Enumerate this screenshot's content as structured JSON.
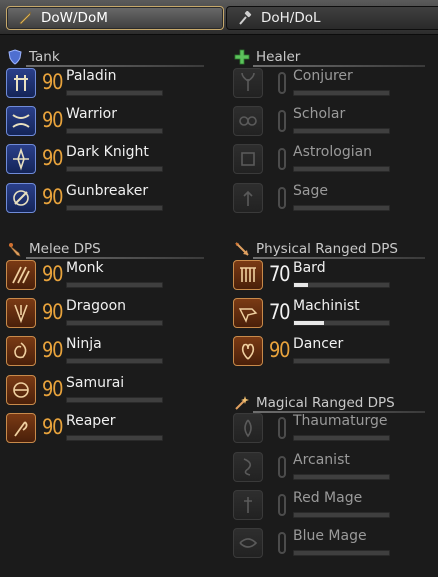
{
  "tabs": [
    {
      "label": "DoW/DoM",
      "icon": "sword-icon"
    },
    {
      "label": "DoH/DoL",
      "icon": "hammer-icon"
    }
  ],
  "sections": {
    "tank": {
      "label": "Tank",
      "icon": "shield-icon"
    },
    "healer": {
      "label": "Healer",
      "icon": "cross-icon"
    },
    "melee": {
      "label": "Melee DPS",
      "icon": "dagger-icon"
    },
    "physical": {
      "label": "Physical Ranged DPS",
      "icon": "arrow-icon"
    },
    "magical": {
      "label": "Magical Ranged DPS",
      "icon": "wand-icon"
    }
  },
  "jobs": {
    "paladin": {
      "name": "Paladin",
      "level": "90",
      "unlocked": true,
      "progress": 0,
      "icon": "paladin-icon"
    },
    "warrior": {
      "name": "Warrior",
      "level": "90",
      "unlocked": true,
      "progress": 0,
      "icon": "warrior-icon"
    },
    "darkknight": {
      "name": "Dark Knight",
      "level": "90",
      "unlocked": true,
      "progress": 0,
      "icon": "dark-knight-icon"
    },
    "gunbreaker": {
      "name": "Gunbreaker",
      "level": "90",
      "unlocked": true,
      "progress": 0,
      "icon": "gunbreaker-icon"
    },
    "conjurer": {
      "name": "Conjurer",
      "level": "",
      "unlocked": false,
      "progress": 0,
      "icon": "conjurer-icon"
    },
    "scholar": {
      "name": "Scholar",
      "level": "",
      "unlocked": false,
      "progress": 0,
      "icon": "scholar-icon"
    },
    "astrologian": {
      "name": "Astrologian",
      "level": "",
      "unlocked": false,
      "progress": 0,
      "icon": "astrologian-icon"
    },
    "sage": {
      "name": "Sage",
      "level": "",
      "unlocked": false,
      "progress": 0,
      "icon": "sage-icon"
    },
    "monk": {
      "name": "Monk",
      "level": "90",
      "unlocked": true,
      "progress": 0,
      "icon": "monk-icon"
    },
    "dragoon": {
      "name": "Dragoon",
      "level": "90",
      "unlocked": true,
      "progress": 0,
      "icon": "dragoon-icon"
    },
    "ninja": {
      "name": "Ninja",
      "level": "90",
      "unlocked": true,
      "progress": 0,
      "icon": "ninja-icon"
    },
    "samurai": {
      "name": "Samurai",
      "level": "90",
      "unlocked": true,
      "progress": 0,
      "icon": "samurai-icon"
    },
    "reaper": {
      "name": "Reaper",
      "level": "90",
      "unlocked": true,
      "progress": 0,
      "icon": "reaper-icon"
    },
    "bard": {
      "name": "Bard",
      "level": "70",
      "unlocked": true,
      "progress": 0.15,
      "icon": "bard-icon"
    },
    "machinist": {
      "name": "Machinist",
      "level": "70",
      "unlocked": true,
      "progress": 0.32,
      "icon": "machinist-icon"
    },
    "dancer": {
      "name": "Dancer",
      "level": "90",
      "unlocked": true,
      "progress": 0,
      "icon": "dancer-icon"
    },
    "thaumaturge": {
      "name": "Thaumaturge",
      "level": "",
      "unlocked": false,
      "progress": 0,
      "icon": "thaumaturge-icon"
    },
    "arcanist": {
      "name": "Arcanist",
      "level": "",
      "unlocked": false,
      "progress": 0,
      "icon": "arcanist-icon"
    },
    "redmage": {
      "name": "Red Mage",
      "level": "",
      "unlocked": false,
      "progress": 0,
      "icon": "red-mage-icon"
    },
    "bluemage": {
      "name": "Blue Mage",
      "level": "",
      "unlocked": false,
      "progress": 0,
      "icon": "blue-mage-icon"
    }
  },
  "colors": {
    "level_max": "#e8a33c",
    "level_normal": "#f2f2f2",
    "tank": "#3f5fb8",
    "melee": "#d08838",
    "ranged": "#d08838",
    "disabled": "#4a4a4a"
  }
}
